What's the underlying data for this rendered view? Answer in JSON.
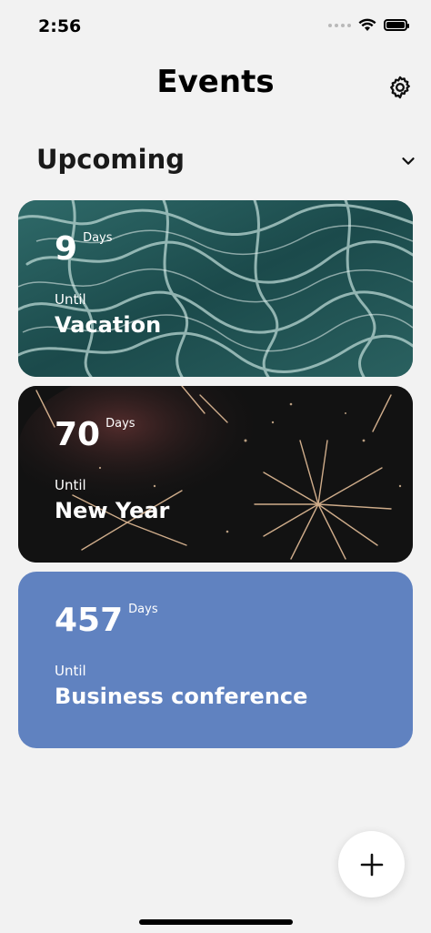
{
  "status_bar": {
    "time": "2:56"
  },
  "header": {
    "title": "Events",
    "settings_icon": "gear-icon"
  },
  "section": {
    "title": "Upcoming",
    "chevron_icon": "chevron-down-icon"
  },
  "events": [
    {
      "days": "9",
      "days_unit": "Days",
      "until_label": "Until",
      "name": "Vacation",
      "background": "water-image"
    },
    {
      "days": "70",
      "days_unit": "Days",
      "until_label": "Until",
      "name": "New Year",
      "background": "fireworks-image"
    },
    {
      "days": "457",
      "days_unit": "Days",
      "until_label": "Until",
      "name": "Business conference",
      "background_color": "#6082c0"
    }
  ],
  "fab": {
    "icon": "plus-icon"
  },
  "colors": {
    "background": "#f2f2f2",
    "business_card": "#6082c0",
    "text": "#111111"
  }
}
